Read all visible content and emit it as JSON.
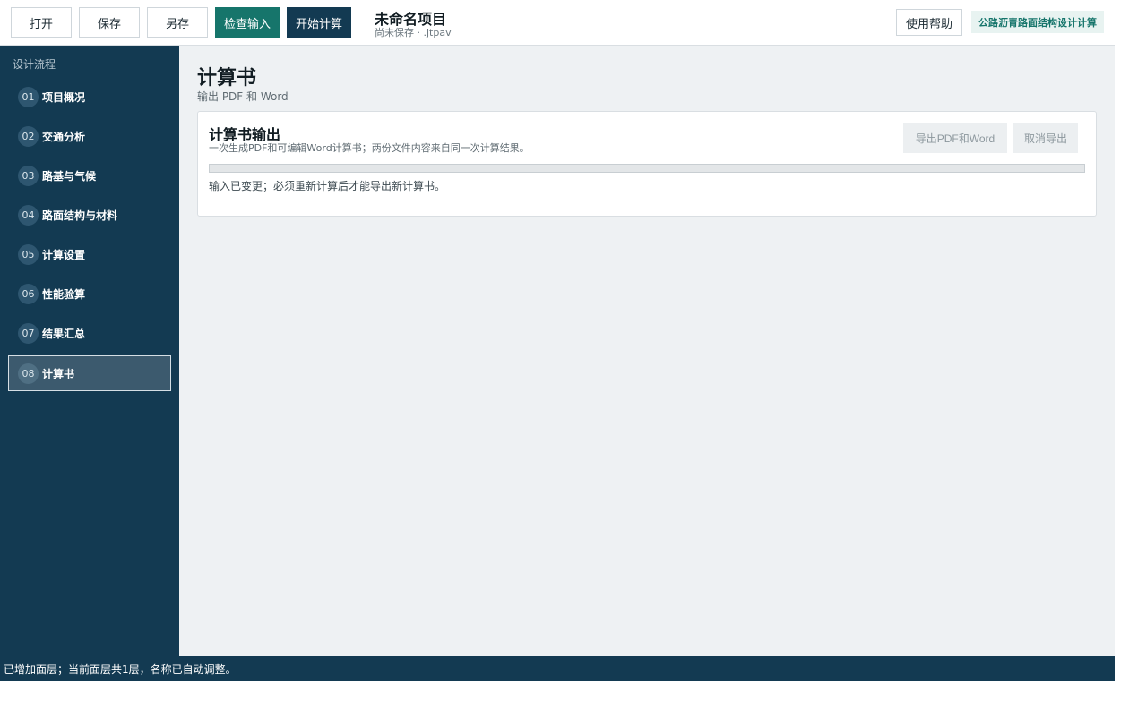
{
  "toolbar": {
    "open_label": "打开",
    "save_label": "保存",
    "save_as_label": "另存",
    "check_input_label": "检查输入",
    "start_calc_label": "开始计算",
    "project_title": "未命名项目",
    "project_subtitle": "尚未保存 · .jtpav",
    "help_label": "使用帮助",
    "app_badge": "公路沥青路面结构设计计算"
  },
  "sidebar": {
    "heading": "设计流程",
    "items": [
      {
        "num": "01",
        "label": "项目概况"
      },
      {
        "num": "02",
        "label": "交通分析"
      },
      {
        "num": "03",
        "label": "路基与气候"
      },
      {
        "num": "04",
        "label": "路面结构与材料"
      },
      {
        "num": "05",
        "label": "计算设置"
      },
      {
        "num": "06",
        "label": "性能验算"
      },
      {
        "num": "07",
        "label": "结果汇总"
      },
      {
        "num": "08",
        "label": "计算书"
      }
    ],
    "active_index": 7
  },
  "main": {
    "title": "计算书",
    "subtitle": "输出 PDF 和 Word",
    "card": {
      "title": "计算书输出",
      "description": "一次生成PDF和可编辑Word计算书；两份文件内容来自同一次计算结果。",
      "export_label": "导出PDF和Word",
      "cancel_label": "取消导出",
      "progress": 0,
      "note": "输入已变更；必须重新计算后才能导出新计算书。"
    }
  },
  "status": {
    "message": "已增加面层；当前面层共1层，名称已自动调整。"
  },
  "colors": {
    "navy": "#133a52",
    "teal": "#16756b",
    "active_nav": "#3c5a6e"
  }
}
